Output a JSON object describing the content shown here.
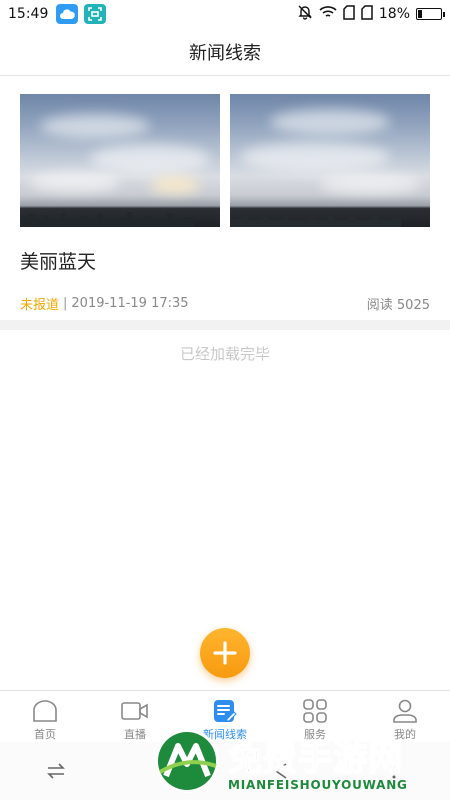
{
  "status_bar": {
    "time": "15:49",
    "battery": "18%",
    "battery_level": 0.18,
    "icons": [
      "weather-cloud-icon",
      "scan-icon",
      "mute-bell-icon",
      "wifi-icon",
      "sim1-icon",
      "sim2-icon",
      "battery-icon"
    ]
  },
  "header": {
    "title": "新闻线索"
  },
  "news": {
    "title": "美丽蓝天",
    "status": "未报道",
    "separator": "|",
    "date": "2019-11-19 17:35",
    "reads": "阅读 5025"
  },
  "list_footer": "已经加载完毕",
  "fab": {
    "icon": "plus-icon"
  },
  "tabs": [
    {
      "label": "首页",
      "icon": "home-icon",
      "active": false
    },
    {
      "label": "直播",
      "icon": "video-icon",
      "active": false
    },
    {
      "label": "新闻线索",
      "icon": "news-clue-icon",
      "active": true
    },
    {
      "label": "服务",
      "icon": "grid-icon",
      "active": false
    },
    {
      "label": "我的",
      "icon": "user-icon",
      "active": false
    }
  ],
  "system_nav": [
    "switch-icon",
    "recent-apps-icon",
    "back-icon",
    "menu-icon"
  ],
  "watermark": {
    "cn": "免费手游网",
    "en": "MIANFEISHOUYOUWANG"
  },
  "colors": {
    "accent_blue": "#2e8ef0",
    "status_orange": "#f0a800",
    "fab_orange": "#f79a10",
    "watermark_green": "#1e8a3c"
  }
}
